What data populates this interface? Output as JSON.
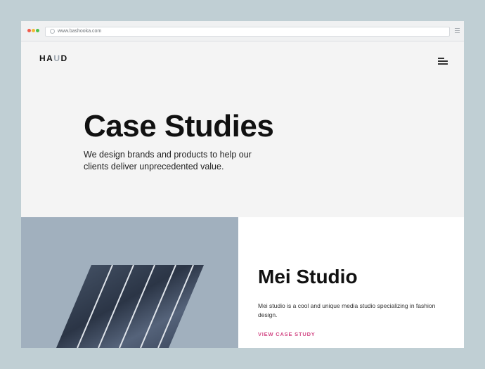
{
  "browser": {
    "url": "www.bashooka.com"
  },
  "site": {
    "logo_prefix": "HA",
    "logo_highlight": "U",
    "logo_suffix": "D",
    "menu_icon": "hamburger-menu-icon"
  },
  "hero": {
    "title": "Case Studies",
    "subtitle": "We design brands and products to help our clients deliver unprecedented value."
  },
  "case_study": {
    "title": "Mei Studio",
    "description": "Mei studio is a cool and unique media studio specializing in fashion design.",
    "link_label": "VIEW CASE STUDY",
    "image": "fashion-stripes-image"
  },
  "colors": {
    "page_bg": "#c0cfd4",
    "hero_bg": "#f4f4f4",
    "image_panel_bg": "#a1b0be",
    "accent_link": "#d34a86",
    "text_dark": "#111111"
  }
}
